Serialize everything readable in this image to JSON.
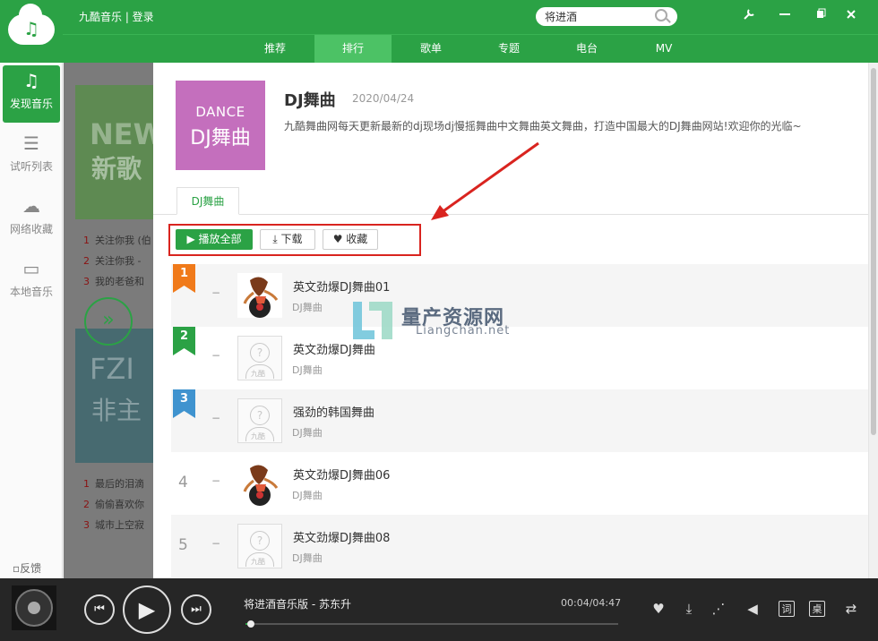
{
  "app": {
    "brand": "九酷音乐 | 登录",
    "search_value": "将进酒"
  },
  "window_controls": [
    "tool",
    "minimize",
    "restore",
    "close"
  ],
  "nav": {
    "tabs": [
      {
        "label": "推荐",
        "active": false
      },
      {
        "label": "排行",
        "active": true
      },
      {
        "label": "歌单",
        "active": false
      },
      {
        "label": "专题",
        "active": false
      },
      {
        "label": "电台",
        "active": false
      },
      {
        "label": "MV",
        "active": false
      }
    ]
  },
  "sidebar": {
    "items": [
      {
        "label": "发现音乐",
        "icon": "music-note-icon",
        "active": true
      },
      {
        "label": "试听列表",
        "icon": "list-icon",
        "active": false
      },
      {
        "label": "网络收藏",
        "icon": "cloud-icon",
        "active": false
      },
      {
        "label": "本地音乐",
        "icon": "monitor-icon",
        "active": false
      }
    ],
    "feedback": "反馈"
  },
  "background": {
    "card1_big": "NEW",
    "card1_small": "新歌",
    "list1": [
      {
        "n": "1",
        "text": "关注你我 (伯"
      },
      {
        "n": "2",
        "text": "关注你我 -"
      },
      {
        "n": "3",
        "text": "我的老爸和"
      }
    ],
    "card2_big": "FZI",
    "card2_small": "非主",
    "list2": [
      {
        "n": "1",
        "text": "最后的泪滴"
      },
      {
        "n": "2",
        "text": "偷偷喜欢你"
      },
      {
        "n": "3",
        "text": "城市上空寂"
      }
    ]
  },
  "chart": {
    "cover_line1": "DANCE",
    "cover_line2": "DJ舞曲",
    "title": "DJ舞曲",
    "date": "2020/04/24",
    "description": "九酷舞曲网每天更新最新的dj现场dj慢摇舞曲中文舞曲英文舞曲，打造中国最大的DJ舞曲网站!欢迎你的光临~",
    "tab": "DJ舞曲",
    "actions": {
      "play_all": "播放全部",
      "download": "下载",
      "favorite": "收藏"
    }
  },
  "tracks": [
    {
      "rank": "1",
      "rank_color": "#f07a1a",
      "flag": true,
      "title": "英文劲爆DJ舞曲01",
      "album": "DJ舞曲",
      "art": true
    },
    {
      "rank": "2",
      "rank_color": "#2ba245",
      "flag": true,
      "title": "英文劲爆DJ舞曲",
      "album": "DJ舞曲",
      "art": false
    },
    {
      "rank": "3",
      "rank_color": "#3f93cf",
      "flag": true,
      "title": "强劲的韩国舞曲",
      "album": "DJ舞曲",
      "art": false
    },
    {
      "rank": "4",
      "rank_color": "#999999",
      "flag": false,
      "title": "英文劲爆DJ舞曲06",
      "album": "DJ舞曲",
      "art": true
    },
    {
      "rank": "5",
      "rank_color": "#999999",
      "flag": false,
      "title": "英文劲爆DJ舞曲08",
      "album": "DJ舞曲",
      "art": false
    }
  ],
  "placeholder_caption": "九酷",
  "watermark": {
    "cn": "量产资源网",
    "en": "Liangchan.net"
  },
  "player": {
    "now_playing": "将进酒音乐版 - 苏东升",
    "time": "00:04/04:47",
    "progress": 0.01,
    "lyric_label": "词",
    "desktop_label": "桌"
  },
  "colors": {
    "accent": "#2ba245",
    "highlight_box": "#d9241f",
    "cover_bg": "#c46fbd"
  }
}
